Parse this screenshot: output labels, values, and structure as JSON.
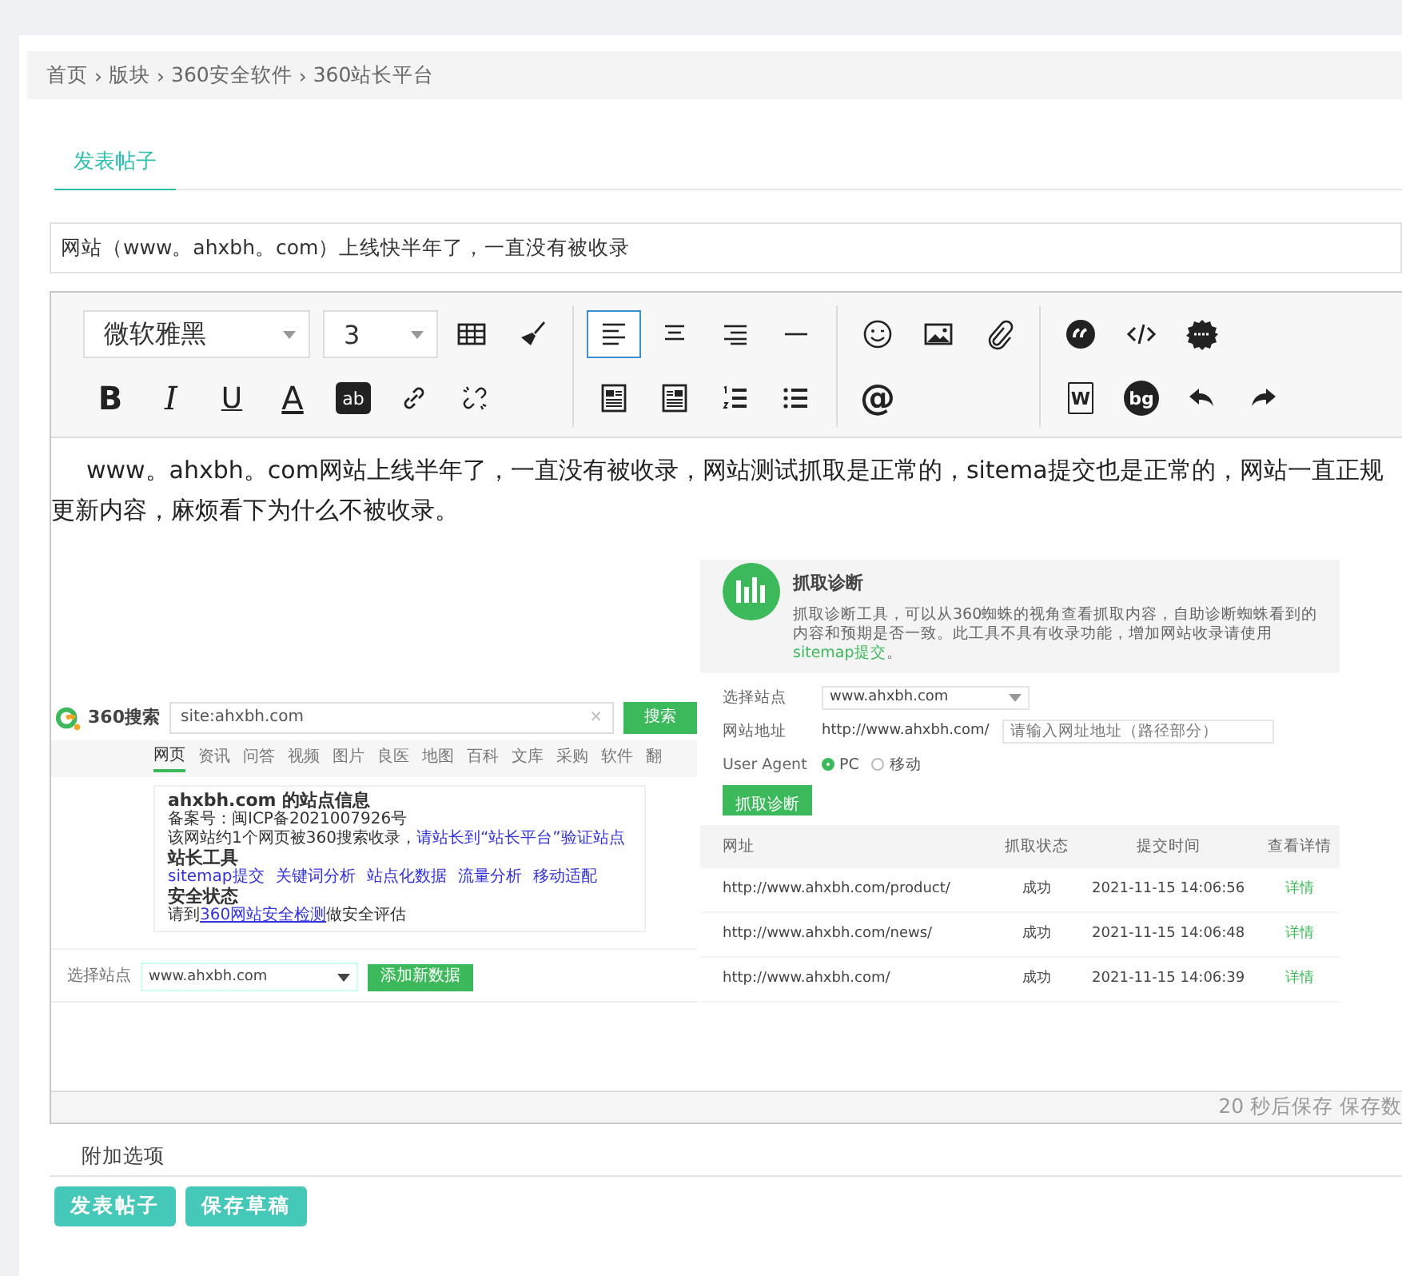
{
  "breadcrumb": [
    {
      "label": "首页"
    },
    {
      "label": "版块"
    },
    {
      "label": "360安全软件"
    },
    {
      "label": "360站长平台"
    }
  ],
  "breadcrumb_separators": [
    "›",
    "›",
    "›"
  ],
  "tabs": [
    {
      "label": "发表帖子",
      "selected": true
    }
  ],
  "subject": {
    "value": "网站（www。ahxbh。com）上线快半年了，一直没有被收录"
  },
  "toolbar": {
    "font": "微软雅黑",
    "size": "3",
    "bold": "B",
    "italic": "I",
    "underline": "U",
    "font_color": "A",
    "highlight": "ab",
    "mention": "@",
    "word": "W",
    "background": "bg",
    "align": [
      {
        "selected": true
      },
      {
        "selected": false
      },
      {
        "selected": false
      }
    ]
  },
  "body": {
    "text": "www。ahxbh。com网站上线半年了，一直没有被收录，网站测试抓取是正常的，sitema提交也是正常的，网站一直正规更新内容，麻烦看下为什么不被收录。"
  },
  "search_screenshot": {
    "logo": "360搜索",
    "query": "site:ahxbh.com",
    "clear": "×",
    "search_button": "搜索",
    "tabs": [
      {
        "label": "网页",
        "selected": true
      },
      {
        "label": "资讯",
        "selected": false
      },
      {
        "label": "问答",
        "selected": false
      },
      {
        "label": "视频",
        "selected": false
      },
      {
        "label": "图片",
        "selected": false
      },
      {
        "label": "良医",
        "selected": false
      },
      {
        "label": "地图",
        "selected": false
      },
      {
        "label": "百科",
        "selected": false
      },
      {
        "label": "文库",
        "selected": false
      },
      {
        "label": "采购",
        "selected": false
      },
      {
        "label": "软件",
        "selected": false
      },
      {
        "label": "翻",
        "selected": false
      }
    ],
    "title": "ahxbh.com 的站点信息",
    "icp": "备案号：闽ICP备2021007926号",
    "indexed": "该网站约1个网页被360搜索收录，",
    "indexed_link": "请站长到“站长平台”验证站点",
    "tools_heading": "站长工具",
    "tools": [
      "sitemap提交",
      "关键词分析",
      "站点化数据",
      "流量分析",
      "移动适配"
    ],
    "security_heading": "安全状态",
    "security_prefix": "请到",
    "security_link": "360网站安全检测",
    "security_suffix": "做安全评估",
    "site_label": "选择站点",
    "site_value": "www.ahxbh.com",
    "add_button": "添加新数据"
  },
  "crawl_screenshot": {
    "title": "抓取诊断",
    "description": "抓取诊断工具，可以从360蜘蛛的视角查看抓取内容，自助诊断蜘蛛看到的内容和预期是否一致。此工具不具有收录功能，增加网站收录请使用",
    "description_link": "sitemap提交",
    "description_end": "。",
    "site_label": "选择站点",
    "site_value": "www.ahxbh.com",
    "url_label": "网站地址",
    "url_prefix": "http://www.ahxbh.com/",
    "url_placeholder": "请输入网址地址（路径部分）",
    "agent_label": "User Agent",
    "agents": [
      {
        "label": "PC",
        "selected": true
      },
      {
        "label": "移动",
        "selected": false
      }
    ],
    "submit": "抓取诊断",
    "columns": [
      "网址",
      "抓取状态",
      "提交时间",
      "查看详情"
    ],
    "rows": [
      {
        "url": "http://www.ahxbh.com/product/",
        "status": "成功",
        "time": "2021-11-15 14:06:56",
        "detail": "详情"
      },
      {
        "url": "http://www.ahxbh.com/news/",
        "status": "成功",
        "time": "2021-11-15 14:06:48",
        "detail": "详情"
      },
      {
        "url": "http://www.ahxbh.com/",
        "status": "成功",
        "time": "2021-11-15 14:06:39",
        "detail": "详情"
      }
    ]
  },
  "status": "20 秒后保存 保存数",
  "extra_options": "附加选项",
  "buttons": [
    "发表帖子",
    "保存草稿"
  ]
}
